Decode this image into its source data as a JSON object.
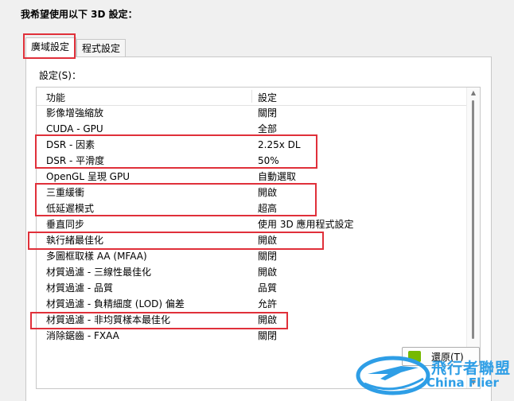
{
  "header": {
    "title": "我希望使用以下 3D 設定："
  },
  "tabs": [
    {
      "label": "廣域設定",
      "active": true
    },
    {
      "label": "程式設定",
      "active": false
    }
  ],
  "settings": {
    "label": "設定(S)：",
    "columns": {
      "feature": "功能",
      "setting": "設定"
    },
    "rows": [
      {
        "feature": "影像增強縮放",
        "setting": "關閉"
      },
      {
        "feature": "CUDA - GPU",
        "setting": "全部"
      },
      {
        "feature": "DSR - 因素",
        "setting": "2.25x DL"
      },
      {
        "feature": "DSR - 平滑度",
        "setting": "50%"
      },
      {
        "feature": "OpenGL 呈現 GPU",
        "setting": "自動選取"
      },
      {
        "feature": "三重緩衝",
        "setting": "開啟"
      },
      {
        "feature": "低延遲模式",
        "setting": "超高"
      },
      {
        "feature": "垂直同步",
        "setting": "使用 3D 應用程式設定"
      },
      {
        "feature": "執行緒最佳化",
        "setting": "開啟"
      },
      {
        "feature": "多圖框取樣 AA (MFAA)",
        "setting": "關閉"
      },
      {
        "feature": "材質過濾 - 三線性最佳化",
        "setting": "開啟"
      },
      {
        "feature": "材質過濾 - 品質",
        "setting": "品質"
      },
      {
        "feature": "材質過濾 - 負精細度 (LOD) 偏差",
        "setting": "允許"
      },
      {
        "feature": "材質過濾 - 非均質樣本最佳化",
        "setting": "開啟"
      },
      {
        "feature": "消除鋸齒 - FXAA",
        "setting": "關閉"
      }
    ]
  },
  "footer": {
    "restore_label": "還原(T)"
  },
  "watermark": {
    "cn": "飛行者聯盟",
    "en": "China Flier"
  },
  "colors": {
    "highlight": "#e0303a",
    "nvidia_green": "#76b900",
    "watermark_blue": "#2e9ee6"
  }
}
